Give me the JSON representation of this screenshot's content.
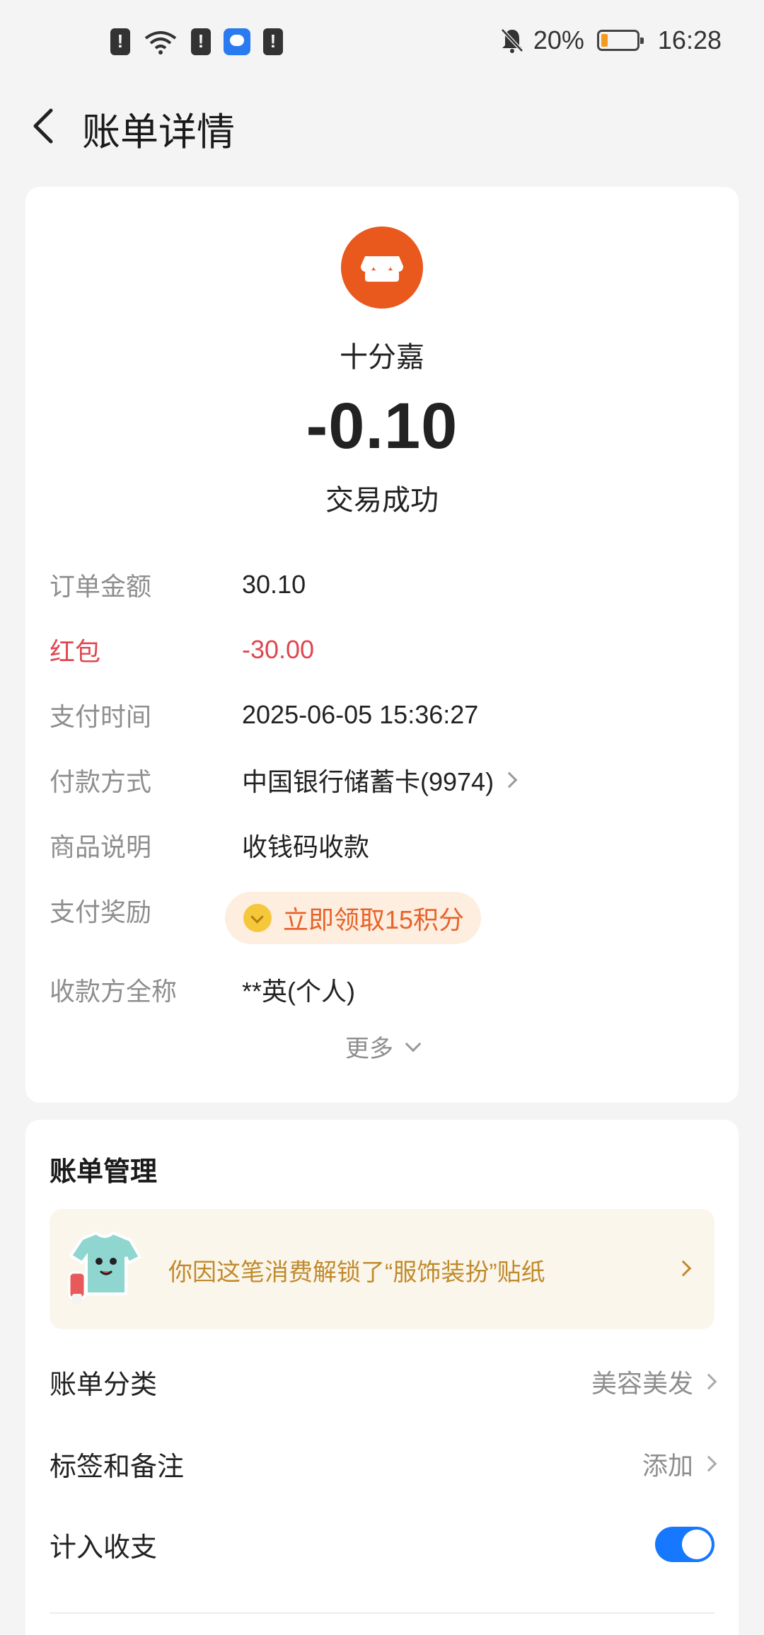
{
  "status_bar": {
    "battery_percent": "20%",
    "time": "16:28",
    "icons": [
      "alert-icon",
      "wifi-icon",
      "alert-icon",
      "qq-icon",
      "alert-icon",
      "bell-off-icon",
      "battery-icon"
    ]
  },
  "header": {
    "title": "账单详情"
  },
  "transaction": {
    "merchant": "十分嘉",
    "amount": "-0.10",
    "status": "交易成功",
    "details": [
      {
        "label": "订单金额",
        "value": "30.10"
      },
      {
        "label": "红包",
        "value": "-30.00"
      },
      {
        "label": "支付时间",
        "value": "2025-06-05 15:36:27"
      },
      {
        "label": "付款方式",
        "value": "中国银行储蓄卡(9974)"
      },
      {
        "label": "商品说明",
        "value": "收钱码收款"
      },
      {
        "label": "支付奖励",
        "value": "立即领取15积分"
      },
      {
        "label": "收款方全称",
        "value": "**英(个人)"
      }
    ],
    "more_label": "更多"
  },
  "bill_management": {
    "title": "账单管理",
    "banner_text": "你因这笔消费解锁了“服饰装扮”贴纸",
    "rows": [
      {
        "label": "账单分类",
        "value": "美容美发"
      },
      {
        "label": "标签和备注",
        "value": "添加"
      },
      {
        "label": "计入收支",
        "toggle": true
      }
    ]
  },
  "colors": {
    "accent_blue": "#1677ff",
    "merchant_orange": "#e9581c",
    "red_packet": "#e04650",
    "reward_orange": "#e8632a",
    "banner_gold": "#c08a2b"
  }
}
